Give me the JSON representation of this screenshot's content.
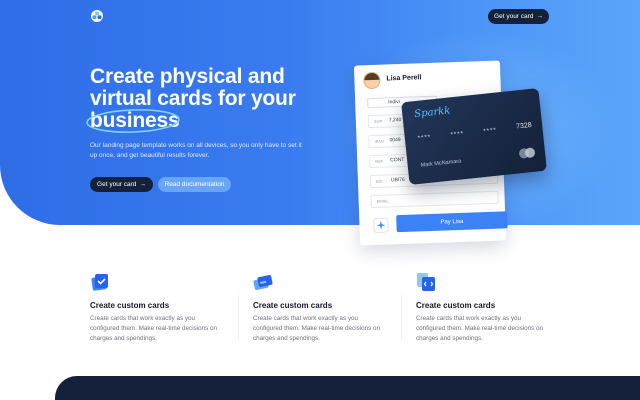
{
  "nav": {
    "cta_label": "Get your card",
    "arrow": "→"
  },
  "hero": {
    "title_line1": "Create physical and",
    "title_line2": "virtual cards for your",
    "title_highlight": "business",
    "subtitle": "Our landing page template works on all devices, so you only have to set it up once, and get beautiful results forever.",
    "primary_button": "Get your card",
    "secondary_button": "Read documentation"
  },
  "payment_form": {
    "name": "Lisa Perell",
    "tab_label": "Indivi",
    "fields": [
      {
        "label": "SUR",
        "value": "7,240"
      },
      {
        "label": "IBAN",
        "value": "0049"
      },
      {
        "label": "REF",
        "value": "CONT"
      },
      {
        "label": "BIC",
        "value": "UBI76"
      },
      {
        "label": "EMAIL",
        "value": ""
      }
    ],
    "pay_button": "Pay Lisa"
  },
  "credit_card": {
    "brand": "Sparkk",
    "masked_groups": [
      "****",
      "****",
      "****"
    ],
    "last_digits": "7328",
    "holder": "Mark McNamara"
  },
  "features": [
    {
      "title": "Create custom cards",
      "description": "Create cards that work exactly as you configured them. Make real-time decisions on charges and spendings."
    },
    {
      "title": "Create custom cards",
      "description": "Create cards that work exactly as you configured them. Make real-time decisions on charges and spendings."
    },
    {
      "title": "Create custom cards",
      "description": "Create cards that work exactly as you configured them. Make real-time decisions on charges and spendings."
    }
  ],
  "colors": {
    "primary": "#3b82f6",
    "navy": "#15213b",
    "hero_start": "#2f6de6",
    "hero_end": "#5ba6fb",
    "highlight_ring": "#7dd3fc"
  },
  "icons": [
    "logo-icon",
    "arrow-right-icon",
    "sparkle-icon",
    "card-check-icon",
    "cards-stack-icon",
    "card-code-icon",
    "mastercard-icon"
  ]
}
